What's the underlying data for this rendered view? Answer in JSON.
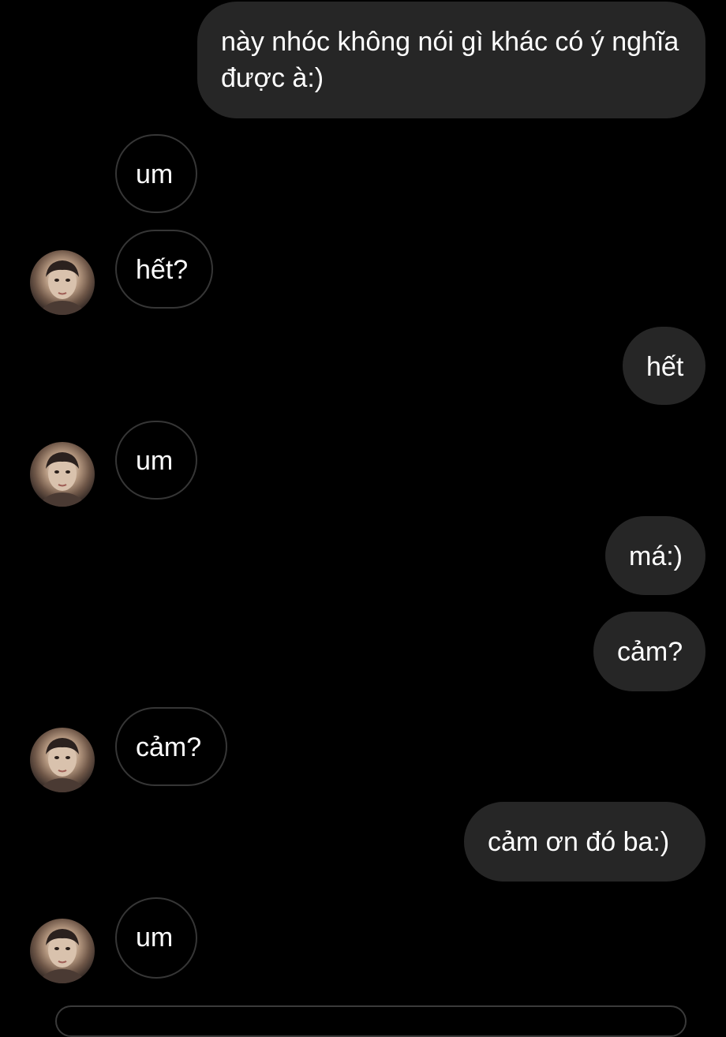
{
  "conversation": {
    "messages": [
      {
        "side": "out",
        "text": "này nhóc không nói gì khác có ý nghĩa được à:)"
      },
      {
        "side": "in",
        "text": "um"
      },
      {
        "side": "in",
        "text": "hết?"
      },
      {
        "side": "out",
        "text": "hết"
      },
      {
        "side": "in",
        "text": "um"
      },
      {
        "side": "out",
        "text": "má:)"
      },
      {
        "side": "out",
        "text": "cảm?"
      },
      {
        "side": "in",
        "text": "cảm?"
      },
      {
        "side": "out",
        "text": "cảm ơn đó ba:)"
      },
      {
        "side": "in",
        "text": "um"
      }
    ]
  },
  "colors": {
    "background": "#000000",
    "outgoing_bubble": "#262626",
    "incoming_border": "#363636",
    "text": "#ffffff"
  },
  "icons": {
    "avatar": "profile-photo"
  }
}
